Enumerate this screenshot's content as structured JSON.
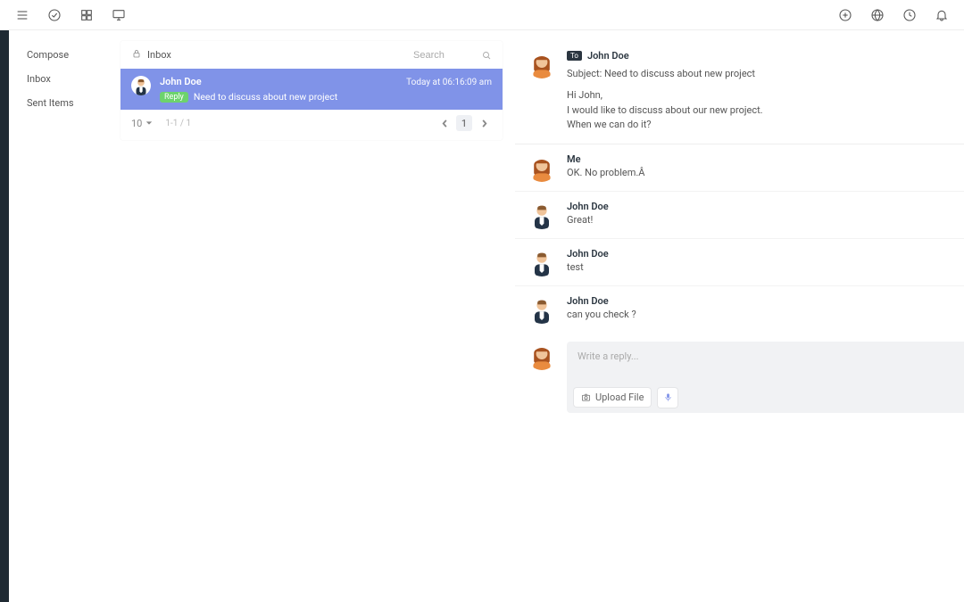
{
  "sidebar": {
    "items": [
      {
        "label": "Compose"
      },
      {
        "label": "Inbox"
      },
      {
        "label": "Sent Items"
      }
    ]
  },
  "list": {
    "title": "Inbox",
    "search_placeholder": "Search",
    "items": [
      {
        "name": "John Doe",
        "time": "Today at 06:16:09 am",
        "reply_badge": "Reply",
        "subject": "Need to discuss about new project"
      }
    ],
    "pager": {
      "per_page": "10",
      "range": "1-1 / 1",
      "current": "1"
    }
  },
  "thread": {
    "to_badge": "To",
    "from": "John Doe",
    "subject_label": "Subject: Need to discuss about new project",
    "body": [
      "Hi John,",
      "I would like to discuss about our new project.",
      "When we can do it?"
    ],
    "replies": [
      {
        "name": "Me",
        "text": "OK. No problem.Â",
        "avatar": "f"
      },
      {
        "name": "John Doe",
        "text": "Great!",
        "avatar": "m"
      },
      {
        "name": "John Doe",
        "text": "test",
        "avatar": "m"
      },
      {
        "name": "John Doe",
        "text": "can you check ?",
        "avatar": "m"
      }
    ],
    "compose": {
      "placeholder": "Write a reply...",
      "upload_label": "Upload File"
    }
  }
}
